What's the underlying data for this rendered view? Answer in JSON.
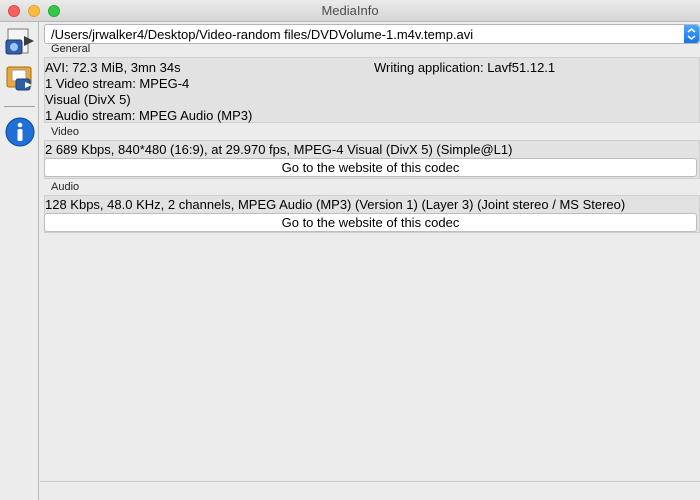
{
  "window": {
    "title": "MediaInfo"
  },
  "sidebar": {
    "items": [
      {
        "icon": "open-file-icon"
      },
      {
        "icon": "open-folder-icon"
      },
      {
        "icon": "info-icon"
      }
    ]
  },
  "file_selector": {
    "value": "/Users/jrwalker4/Desktop/Video-random files/DVDVolume-1.m4v.temp.avi"
  },
  "general": {
    "label": "General",
    "line1_left": "AVI: 72.3 MiB, 3mn 34s",
    "line1_right": "Writing application: Lavf51.12.1",
    "line2": "1 Video stream: MPEG-4",
    "line3": "Visual (DivX 5)",
    "line4": "1 Audio stream: MPEG Audio (MP3)"
  },
  "video": {
    "label": "Video",
    "info": "2 689 Kbps, 840*480 (16:9), at 29.970 fps, MPEG-4 Visual (DivX 5) (Simple@L1)",
    "button": "Go to the website of this codec"
  },
  "audio": {
    "label": "Audio",
    "info": "128 Kbps, 48.0 KHz, 2 channels, MPEG Audio (MP3) (Version 1) (Layer 3) (Joint stereo / MS Stereo)",
    "button": "Go to the website of this codec"
  },
  "colors": {
    "accent": "#1a73e8",
    "panel": "#e2e2e2",
    "window": "#ececec"
  }
}
